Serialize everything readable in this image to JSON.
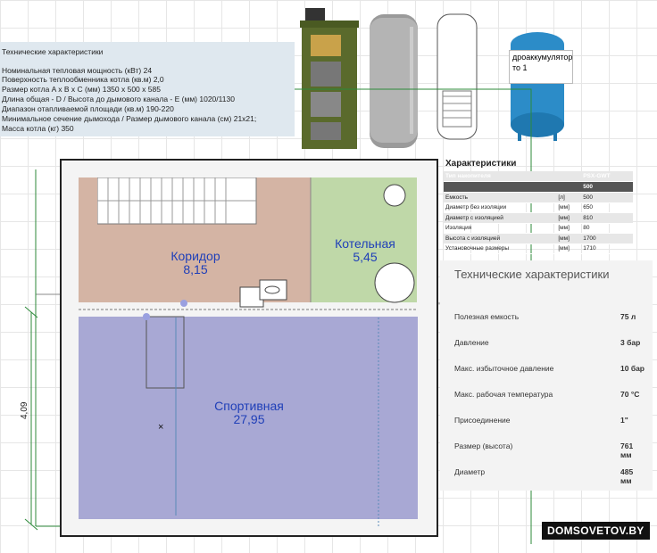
{
  "boiler_specs": {
    "title": "Технические характеристики",
    "lines": [
      "Номинальная тепловая мощность (кВт) 24",
      "Поверхность теплообменника котла (кв.м) 2,0",
      "Размер котла A x B x C (мм) 1350 x 500 x 585",
      "Длина общая - D / Высота до дымового канала - E (мм) 1020/1130",
      "Диапазон отапливаемой площади (кв.м) 190-220",
      "Минимальное сечение дымохода / Размер дымового канала (см) 21x21;",
      "Масса котла (кг) 350"
    ]
  },
  "tooltip": {
    "line1": "дроаккумулятор,",
    "line2": "то 1"
  },
  "rooms": {
    "corridor": {
      "name": "Коридор",
      "area": "8,15"
    },
    "boiler": {
      "name": "Котельная",
      "area": "5,45"
    },
    "sport": {
      "name": "Спортивная",
      "area": "27,95"
    }
  },
  "dimension": {
    "value": "4,09"
  },
  "tank_table": {
    "title": "Характеристики",
    "header_param": "Тип накопителя",
    "header_model": "PSX-GWT",
    "header_sub": "500",
    "rows": [
      [
        "Емкость",
        "[л]",
        "500"
      ],
      [
        "Диаметр без изоляции",
        "[мм]",
        "650"
      ],
      [
        "Диаметр с изоляцией",
        "[мм]",
        "810"
      ],
      [
        "Изоляция",
        "[мм]",
        "80"
      ],
      [
        "Высота с изоляцией",
        "[мм]",
        "1700"
      ],
      [
        "Установочные размеры",
        "[мм]",
        "1710"
      ]
    ]
  },
  "accumulator_specs": {
    "title": "Технические характеристики",
    "rows": [
      {
        "label": "Полезная емкость",
        "value": "75 л"
      },
      {
        "label": "Давление",
        "value": "3 бар"
      },
      {
        "label": "Макс. избыточное давление",
        "value": "10 бар"
      },
      {
        "label": "Макс. рабочая температура",
        "value": "70 °C"
      },
      {
        "label": "Присоединение",
        "value": "1\""
      },
      {
        "label": "Размер (высота)",
        "value": "761 мм"
      },
      {
        "label": "Диаметр",
        "value": "485 мм"
      }
    ]
  },
  "watermark": "DOMSOVETOV.BY"
}
